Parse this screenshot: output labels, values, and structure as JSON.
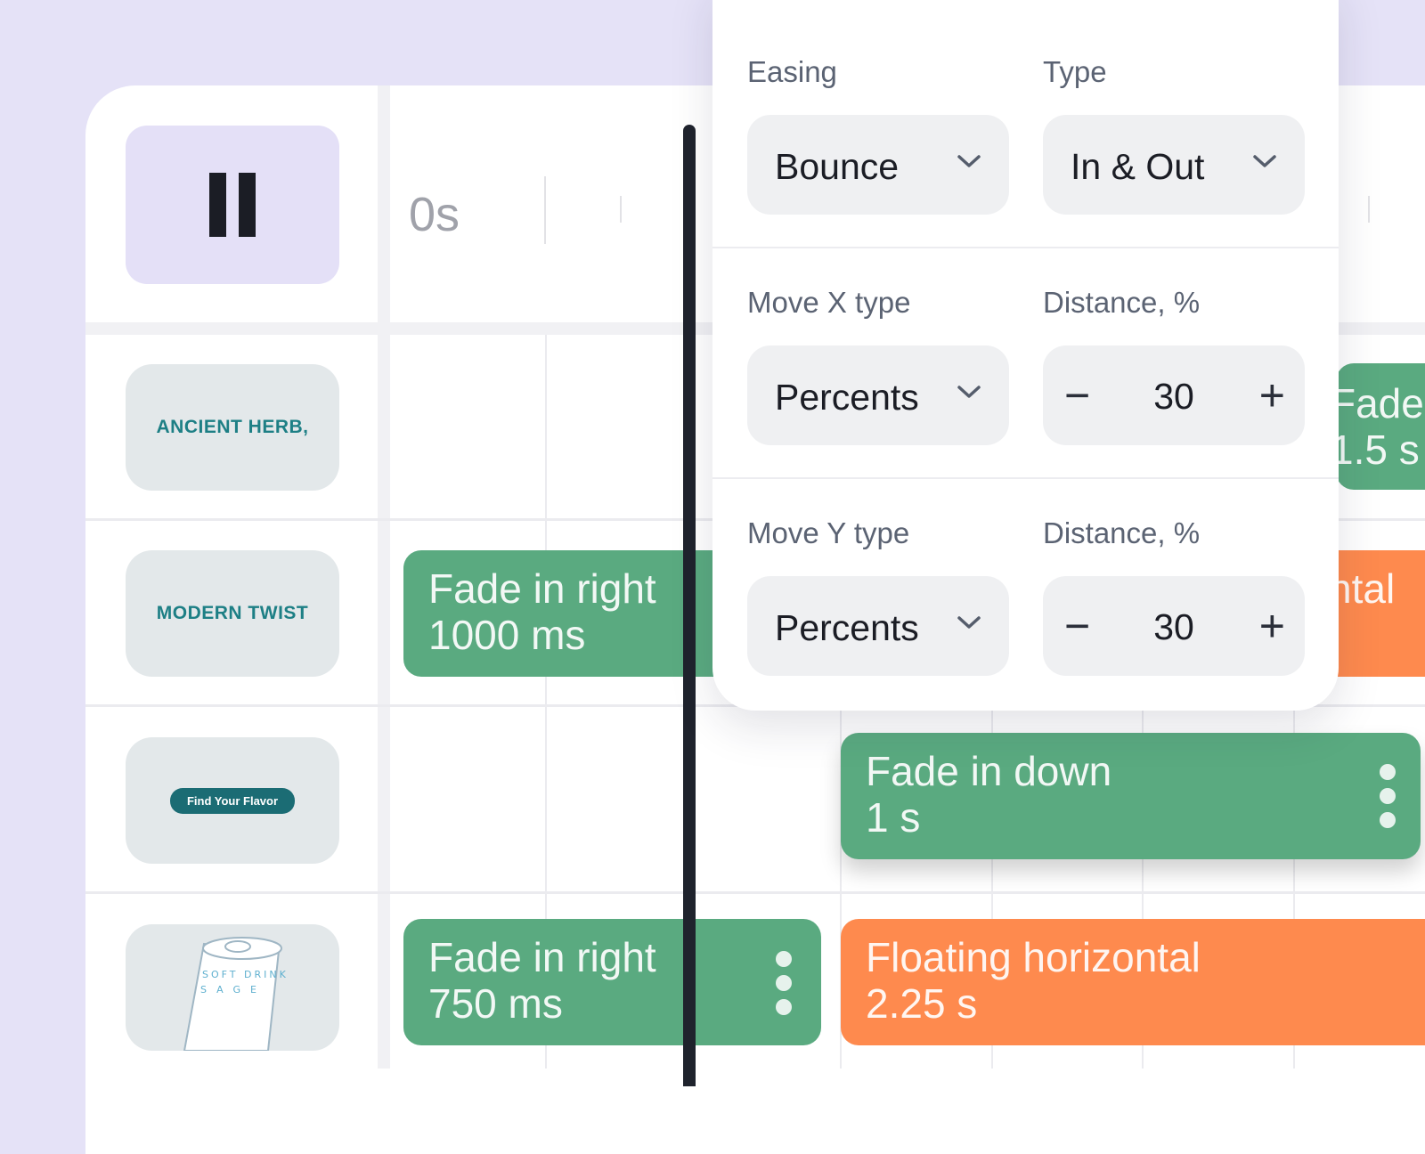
{
  "controls": {
    "pause_label": "Pause"
  },
  "timeline": {
    "start_tick": "0s"
  },
  "layers": [
    {
      "thumb": "ANCIENT HERB,"
    },
    {
      "thumb": "MODERN TWIST"
    },
    {
      "thumb": "Find Your Flavor"
    },
    {
      "thumb": "SOFT DRINK SAGE"
    }
  ],
  "clips": {
    "row1_right": {
      "title": "Fade",
      "duration": "1.5 s"
    },
    "row2_left": {
      "title": "Fade in right",
      "duration": "1000 ms"
    },
    "row2_right": {
      "title": "ntal"
    },
    "row3": {
      "title": "Fade in down",
      "duration": "1 s"
    },
    "row4_left": {
      "title": "Fade in right",
      "duration": "750 ms"
    },
    "row4_right": {
      "title": "Floating horizontal",
      "duration": "2.25 s"
    }
  },
  "panel": {
    "easing_label": "Easing",
    "easing_value": "Bounce",
    "type_label": "Type",
    "type_value": "In & Out",
    "movex_label": "Move X type",
    "movex_value": "Percents",
    "distance_x_label": "Distance, %",
    "distance_x_value": "30",
    "movey_label": "Move Y type",
    "movey_value": "Percents",
    "distance_y_label": "Distance, %",
    "distance_y_value": "30",
    "minus_symbol": "−",
    "plus_symbol": "+"
  },
  "colors": {
    "background": "#e5e2f7",
    "clip_green": "#5aaa80",
    "clip_orange": "#fe8a4e",
    "thumb_text": "#1d7f85",
    "playhead": "#1f232d"
  }
}
